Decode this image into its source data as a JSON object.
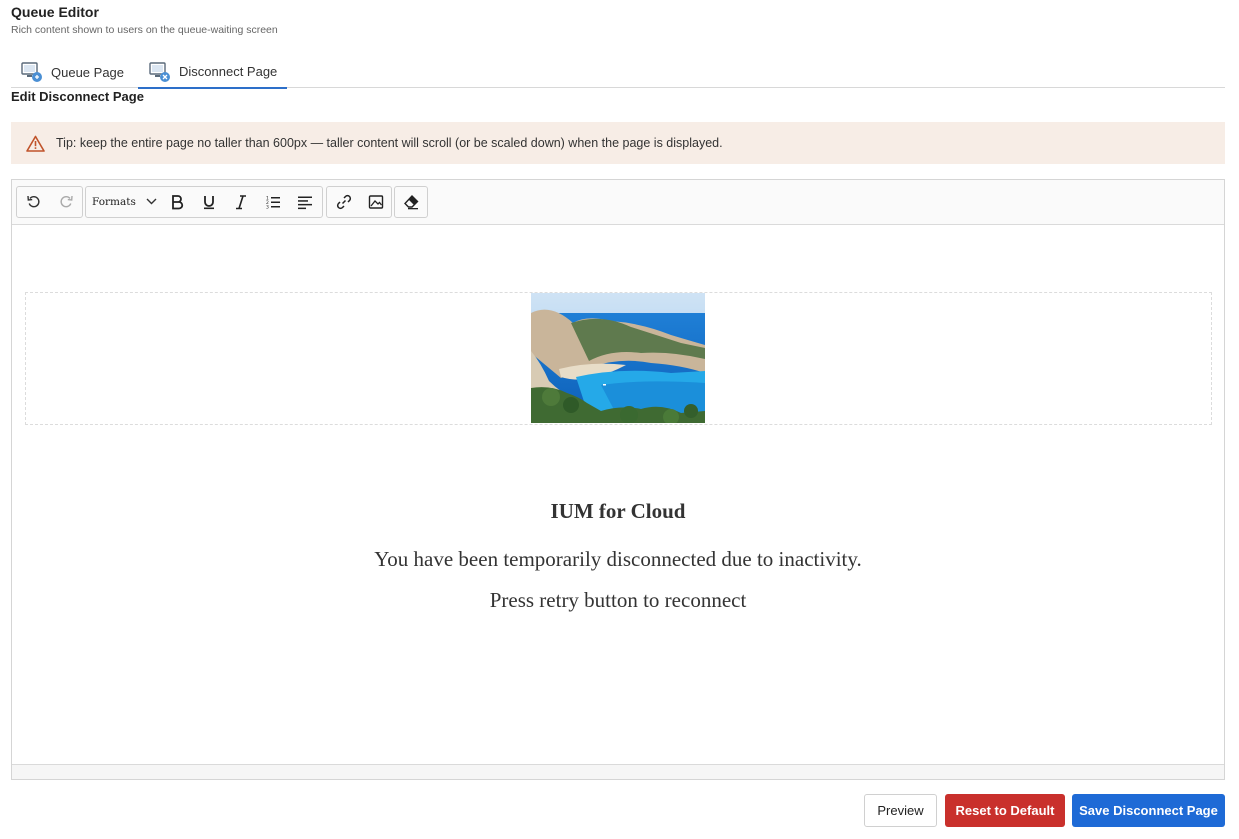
{
  "header": {
    "title": "Queue Editor",
    "subtitle": "Rich content shown to users on the queue-waiting screen"
  },
  "tabs": [
    {
      "label": "Queue Page",
      "icon": "monitor-queue-icon",
      "active": false
    },
    {
      "label": "Disconnect Page",
      "icon": "monitor-disconnect-icon",
      "active": true
    }
  ],
  "section_title": "Edit Disconnect Page",
  "tip": {
    "icon": "warning-icon",
    "text": "Tip: keep the entire page no taller than 600px — taller content will scroll (or be scaled down) when the page is displayed."
  },
  "toolbar": {
    "formats_label": "Formats",
    "buttons": [
      "undo-icon",
      "redo-icon",
      "bold-icon",
      "underline-icon",
      "italic-icon",
      "ordered-list-icon",
      "align-left-icon",
      "link-icon",
      "image-icon",
      "clear-format-icon"
    ]
  },
  "content": {
    "title": "IUM for Cloud",
    "line1": "You have been temporarily disconnected due to inactivity.",
    "line2": "Press retry button to reconnect"
  },
  "actions": {
    "preview": "Preview",
    "reset": "Reset to Default",
    "save": "Save Disconnect Page"
  },
  "colors": {
    "accent": "#1e6ad6",
    "danger": "#c9302c",
    "tip_bg": "#f7ede6",
    "tab_underline": "#2d6fc9"
  }
}
